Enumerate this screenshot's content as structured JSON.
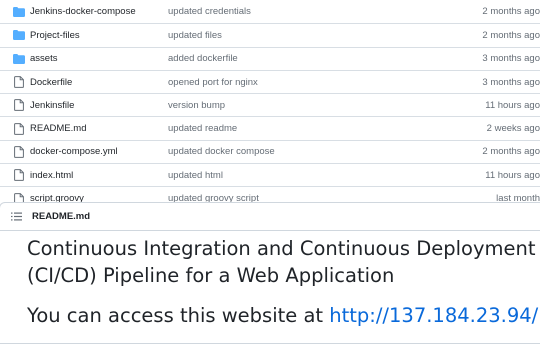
{
  "files": [
    {
      "type": "folder",
      "name": "Jenkins-docker-compose",
      "message": "updated credentials",
      "age": "2 months ago"
    },
    {
      "type": "folder",
      "name": "Project-files",
      "message": "updated files",
      "age": "2 months ago"
    },
    {
      "type": "folder",
      "name": "assets",
      "message": "added dockerfile",
      "age": "3 months ago"
    },
    {
      "type": "file",
      "name": "Dockerfile",
      "message": "opened port for nginx",
      "age": "3 months ago"
    },
    {
      "type": "file",
      "name": "Jenkinsfile",
      "message": "version bump",
      "age": "11 hours ago"
    },
    {
      "type": "file",
      "name": "README.md",
      "message": "updated readme",
      "age": "2 weeks ago"
    },
    {
      "type": "file",
      "name": "docker-compose.yml",
      "message": "updated docker compose",
      "age": "2 months ago"
    },
    {
      "type": "file",
      "name": "index.html",
      "message": "updated html",
      "age": "11 hours ago"
    },
    {
      "type": "file",
      "name": "script.groovy",
      "message": "updated groovy script",
      "age": "last month"
    }
  ],
  "readme": {
    "filename": "README.md",
    "heading": "Continuous Integration and Continuous Deployment (CI/CD) Pipeline for a Web Application",
    "access_prefix": "You can access this website at ",
    "access_link": "http://137.184.23.94/"
  },
  "colors": {
    "folder": "#54aeff",
    "link": "#0969da",
    "muted": "#656d76"
  }
}
